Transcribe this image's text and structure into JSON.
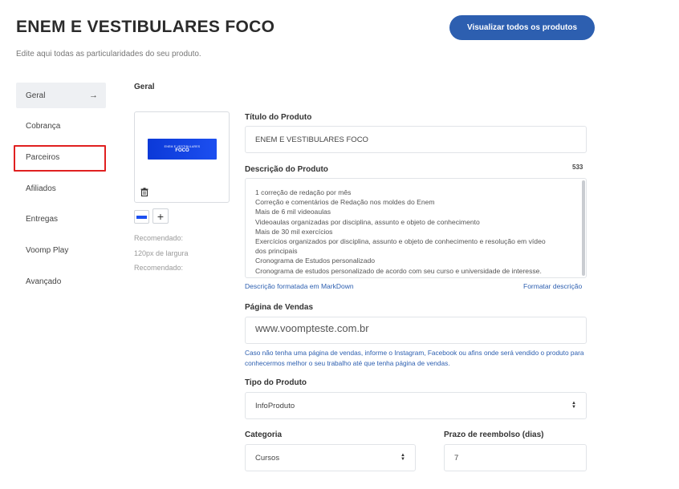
{
  "header": {
    "title": "ENEM E VESTIBULARES FOCO",
    "subtitle": "Edite aqui todas as particularidades do seu produto.",
    "view_all_label": "Visualizar todos os produtos"
  },
  "sidebar": {
    "items": [
      {
        "label": "Geral",
        "active": true
      },
      {
        "label": "Cobrança"
      },
      {
        "label": "Parceiros",
        "highlighted": true
      },
      {
        "label": "Afiliados"
      },
      {
        "label": "Entregas"
      },
      {
        "label": "Voomp Play"
      },
      {
        "label": "Avançado"
      }
    ],
    "active_arrow": "→"
  },
  "section": {
    "title": "Geral"
  },
  "image": {
    "banner_small_text": "ENEM E VESTIBULARES",
    "banner_big_text": "FOCO",
    "add_label": "+",
    "hint_1": "Recomendado:",
    "hint_2": "120px de largura",
    "hint_3": "Recomendado:"
  },
  "product_title": {
    "label": "Título do Produto",
    "value": "ENEM E VESTIBULARES FOCO"
  },
  "description": {
    "label": "Descrição do Produto",
    "char_count": "533",
    "lines": [
      "1 correção de redação por mês",
      "Correção e comentários de Redação nos moldes do Enem",
      "Mais de 6 mil videoaulas",
      "Videoaulas organizadas por disciplina, assunto e objeto de conhecimento",
      "Mais de 30 mil exercícios",
      "Exercícios organizados por disciplina, assunto e objeto de conhecimento e resolução em vídeo",
      "dos principais",
      "Cronograma de Estudos personalizado",
      "Cronograma de estudos personalizado de acordo com seu curso e universidade de interesse."
    ],
    "markdown_link": "Descrição formatada em MarkDown",
    "format_link": "Formatar descrição"
  },
  "sales_page": {
    "label": "Página de Vendas",
    "value": "www.voompteste.com.br",
    "help": "Caso não tenha uma página de vendas, informe o Instagram, Facebook ou afins onde será vendido o produto para conhecermos melhor o seu trabalho até que tenha página de vendas."
  },
  "product_type": {
    "label": "Tipo do Produto",
    "value": "InfoProduto"
  },
  "category": {
    "label": "Categoria",
    "value": "Cursos"
  },
  "refund": {
    "label": "Prazo de reembolso (dias)",
    "value": "7"
  },
  "colors": {
    "primary": "#2d5fb0",
    "highlight": "#e02020",
    "banner": "#1c4ff0"
  }
}
